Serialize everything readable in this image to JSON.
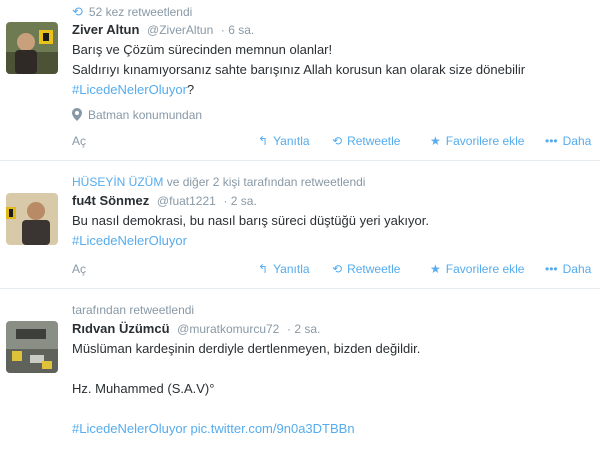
{
  "tweets": [
    {
      "context": "52 kez retweetlendi",
      "fullname": "Ziver Altun",
      "username": "@ZiverAltun",
      "time": "· 6 sa.",
      "lines": [
        "Barış ve Çözüm sürecinden memnun olanlar!",
        "Saldırıyı kınamıyorsanız sahte barışınız Allah korusun kan olarak size dönebilir"
      ],
      "hashtag": "#LicedeNelerOluyor",
      "hashtag_suffix": "?",
      "geo": "Batman konumundan",
      "actions": {
        "open": "Aç",
        "reply": "Yanıtla",
        "retweet": "Retweetle",
        "favorite": "Favorilere ekle",
        "more": "Daha"
      }
    },
    {
      "context_user": "HÜSEYİN ÜZÜM",
      "context": "ve diğer 2 kişi tarafından retweetlendi",
      "fullname": "fu4t Sönmez",
      "username": "@fuat1221",
      "time": "· 2 sa.",
      "lines": [
        "Bu nasıl demokrasi, bu nasıl barış süreci düştüğü yeri yakıyor."
      ],
      "hashtag": "#LicedeNelerOluyor",
      "actions": {
        "open": "Aç",
        "reply": "Yanıtla",
        "retweet": "Retweetle",
        "favorite": "Favorilere ekle",
        "more": "Daha"
      }
    },
    {
      "context": "tarafından retweetlendi",
      "fullname": "Rıdvan Üzümcü",
      "username": "@muratkomurcu72",
      "time": "· 2 sa.",
      "lines": [
        "Müslüman kardeşinin derdiyle dertlenmeyen, bizden değildir.",
        "Hz. Muhammed (S.A.V)°"
      ],
      "hashtag": "#LicedeNelerOluyor",
      "link": "pic.twitter.com/9n0a3DTBBn"
    }
  ],
  "colors": {
    "accent": "#55acee",
    "muted": "#8899a6",
    "text": "#292f33",
    "divider": "#e6ecf0"
  },
  "icons": {
    "retweet": "retweet-icon",
    "reply": "reply-icon",
    "favorite": "star-icon",
    "more": "more-dots-icon",
    "geo": "map-pin-icon"
  }
}
